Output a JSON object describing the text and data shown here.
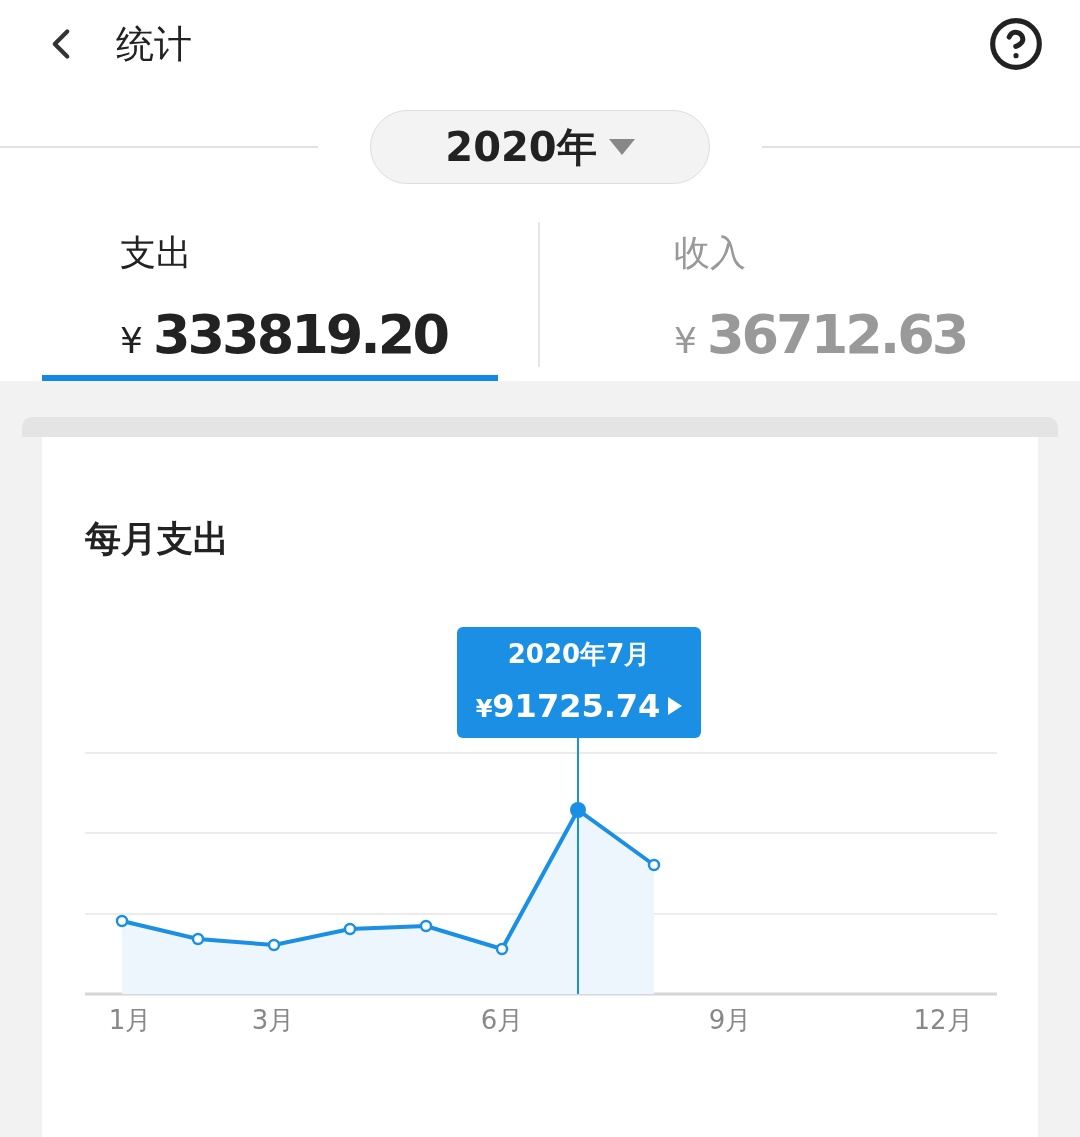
{
  "header": {
    "title": "统计"
  },
  "year_selector": {
    "label": "2020年"
  },
  "tabs": [
    {
      "label": "支出",
      "currency": "¥",
      "amount": "333819.20",
      "selected": true
    },
    {
      "label": "收入",
      "currency": "¥",
      "amount": "36712.63",
      "selected": false
    }
  ],
  "card": {
    "title": "每月支出",
    "tooltip": {
      "date": "2020年7月",
      "currency": "¥",
      "amount": "91725.74"
    },
    "x_labels": [
      "1月",
      "3月",
      "6月",
      "9月",
      "12月"
    ]
  }
}
